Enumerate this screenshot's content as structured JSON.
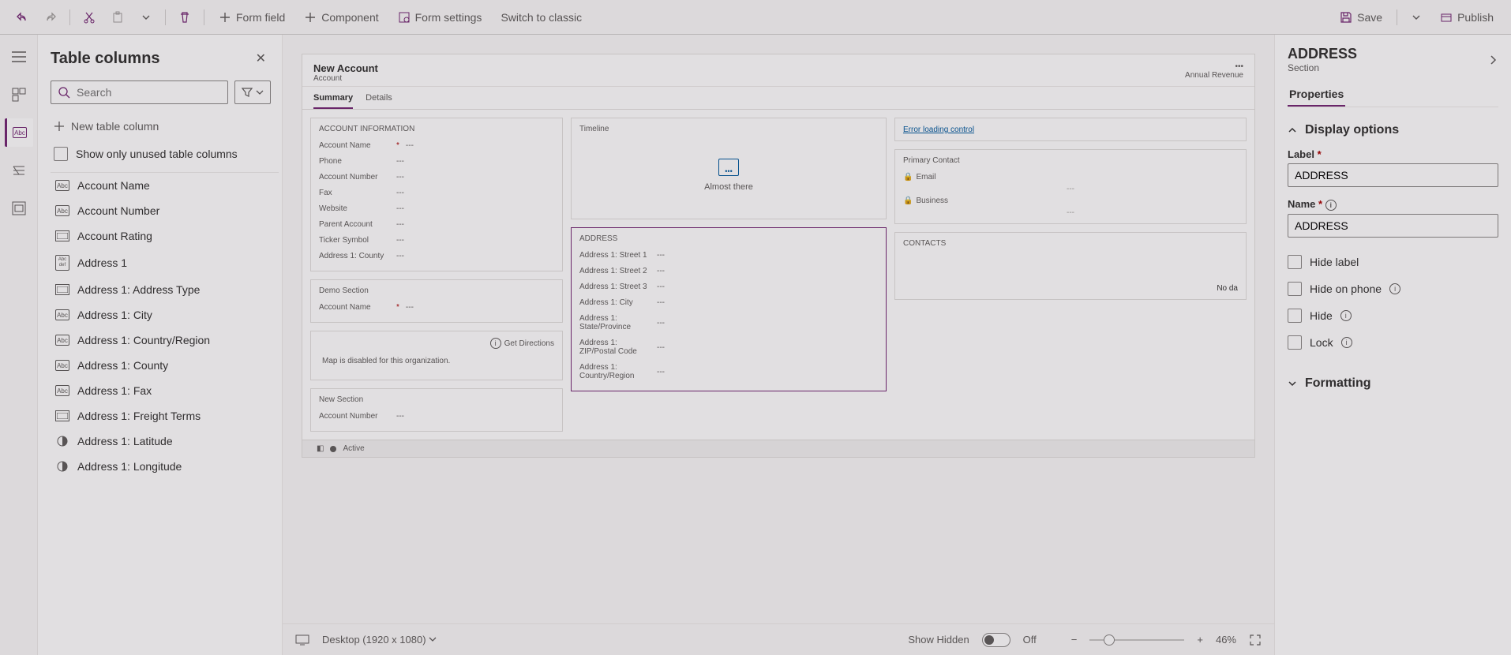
{
  "toolbar": {
    "form_field": "Form field",
    "component": "Component",
    "form_settings": "Form settings",
    "switch_classic": "Switch to classic",
    "save": "Save",
    "publish": "Publish"
  },
  "columns_panel": {
    "title": "Table columns",
    "search_placeholder": "Search",
    "new_column": "New table column",
    "show_unused": "Show only unused table columns",
    "items": [
      {
        "icon": "abc",
        "label": "Account Name"
      },
      {
        "icon": "abc",
        "label": "Account Number"
      },
      {
        "icon": "opt",
        "label": "Account Rating"
      },
      {
        "icon": "abcdef",
        "label": "Address 1"
      },
      {
        "icon": "opt",
        "label": "Address 1: Address Type"
      },
      {
        "icon": "abc",
        "label": "Address 1: City"
      },
      {
        "icon": "abc",
        "label": "Address 1: Country/Region"
      },
      {
        "icon": "abc",
        "label": "Address 1: County"
      },
      {
        "icon": "abc",
        "label": "Address 1: Fax"
      },
      {
        "icon": "opt",
        "label": "Address 1: Freight Terms"
      },
      {
        "icon": "geo",
        "label": "Address 1: Latitude"
      },
      {
        "icon": "geo",
        "label": "Address 1: Longitude"
      }
    ]
  },
  "canvas": {
    "header": {
      "title": "New Account",
      "sub": "Account",
      "right_label": "Annual Revenue"
    },
    "tabs": [
      {
        "label": "Summary",
        "active": true
      },
      {
        "label": "Details",
        "active": false
      }
    ],
    "col1": {
      "acct_info": {
        "title": "ACCOUNT INFORMATION",
        "fields": [
          {
            "label": "Account Name",
            "req": true,
            "val": "---"
          },
          {
            "label": "Phone",
            "req": false,
            "val": "---"
          },
          {
            "label": "Account Number",
            "req": false,
            "val": "---"
          },
          {
            "label": "Fax",
            "req": false,
            "val": "---"
          },
          {
            "label": "Website",
            "req": false,
            "val": "---"
          },
          {
            "label": "Parent Account",
            "req": false,
            "val": "---"
          },
          {
            "label": "Ticker Symbol",
            "req": false,
            "val": "---"
          },
          {
            "label": "Address 1: County",
            "req": false,
            "val": "---"
          }
        ]
      },
      "demo": {
        "title": "Demo Section",
        "fields": [
          {
            "label": "Account Name",
            "req": true,
            "val": "---"
          }
        ]
      },
      "map": {
        "get_directions": "Get Directions",
        "msg": "Map is disabled for this organization."
      },
      "new_sec": {
        "title": "New Section",
        "fields": [
          {
            "label": "Account Number",
            "req": false,
            "val": "---"
          }
        ]
      }
    },
    "col2": {
      "timeline": {
        "title": "Timeline",
        "msg": "Almost there"
      },
      "address": {
        "title": "ADDRESS",
        "fields": [
          {
            "label": "Address 1: Street 1",
            "val": "---"
          },
          {
            "label": "Address 1: Street 2",
            "val": "---"
          },
          {
            "label": "Address 1: Street 3",
            "val": "---"
          },
          {
            "label": "Address 1: City",
            "val": "---"
          },
          {
            "label": "Address 1: State/Province",
            "val": "---"
          },
          {
            "label": "Address 1: ZIP/Postal Code",
            "val": "---"
          },
          {
            "label": "Address 1: Country/Region",
            "val": "---"
          }
        ]
      }
    },
    "col3": {
      "error_link": "Error loading control",
      "primary_contact": {
        "title": "Primary Contact",
        "email": "Email",
        "business": "Business"
      },
      "contacts_title": "CONTACTS",
      "no_data": "No da"
    },
    "status": {
      "state": "Active"
    },
    "footer": {
      "viewport": "Desktop (1920 x 1080)",
      "show_hidden": "Show Hidden",
      "toggle_state": "Off",
      "zoom": "46%"
    }
  },
  "props": {
    "title": "ADDRESS",
    "subtitle": "Section",
    "tab": "Properties",
    "display_options": "Display options",
    "label_lbl": "Label",
    "label_val": "ADDRESS",
    "name_lbl": "Name",
    "name_val": "ADDRESS",
    "hide_label": "Hide label",
    "hide_phone": "Hide on phone",
    "hide": "Hide",
    "lock": "Lock",
    "formatting": "Formatting"
  }
}
